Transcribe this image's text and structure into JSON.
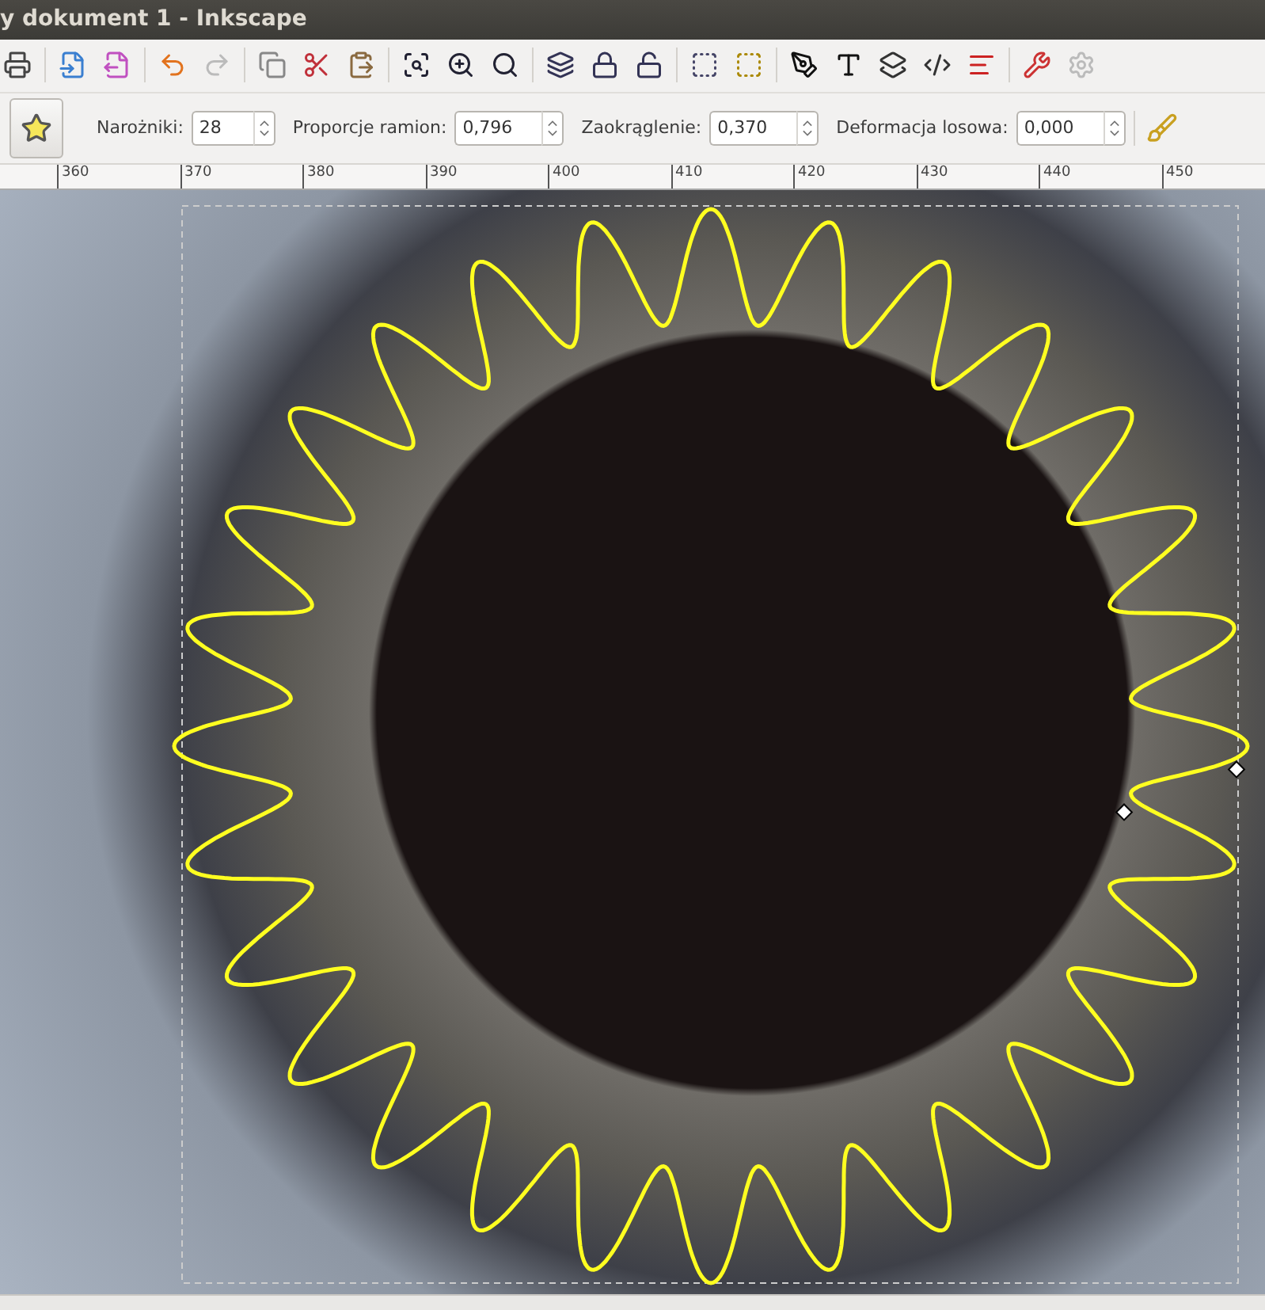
{
  "window": {
    "title": "y dokument 1 - Inkscape"
  },
  "tool_controls": {
    "fields": [
      {
        "label": "Narożniki:",
        "value": "28"
      },
      {
        "label": "Proporcje ramion:",
        "value": "0,796"
      },
      {
        "label": "Zaokrąglenie:",
        "value": "0,370"
      },
      {
        "label": "Deformacja losowa:",
        "value": "0,000"
      }
    ]
  },
  "ruler": {
    "labels": [
      "360",
      "370",
      "380",
      "390",
      "400",
      "410",
      "420",
      "430",
      "440",
      "450"
    ]
  }
}
